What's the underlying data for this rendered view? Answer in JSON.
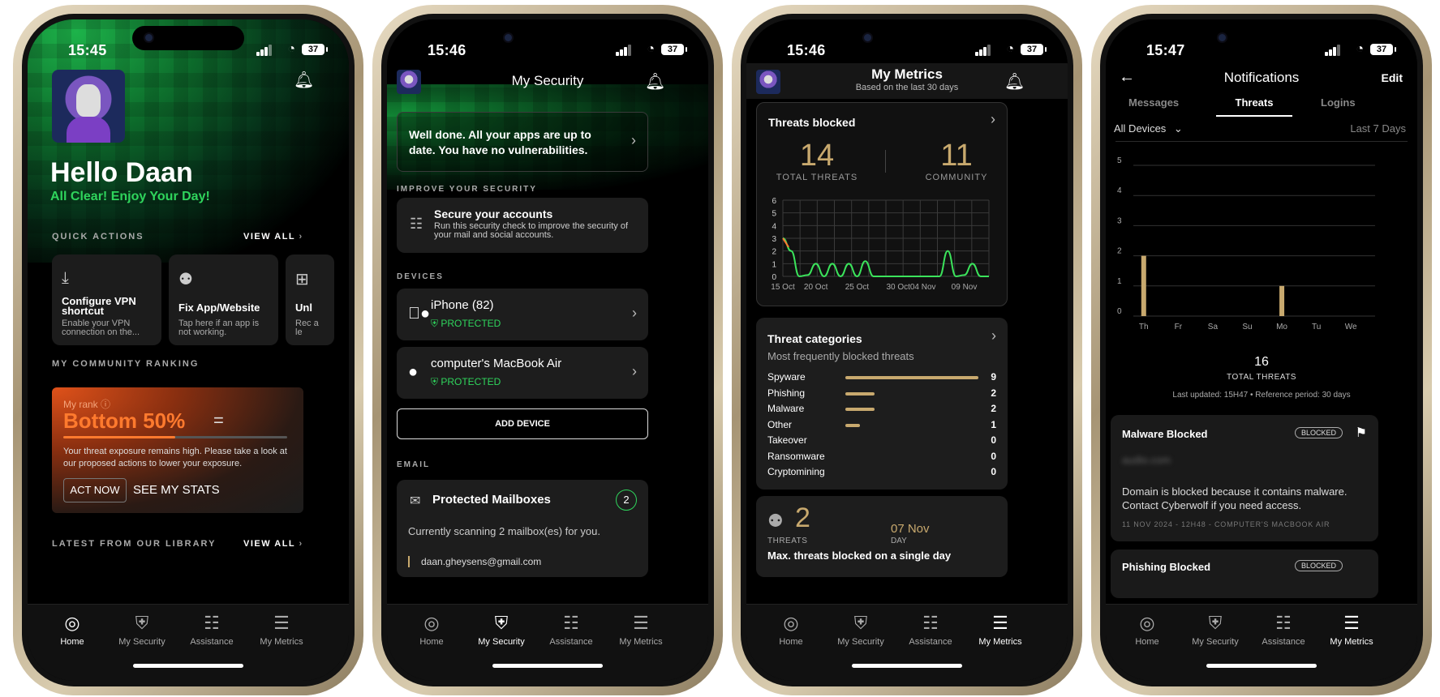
{
  "status": {
    "time1": "15:45",
    "time2": "15:46",
    "time3": "15:46",
    "time4": "15:47",
    "battery": "37"
  },
  "tabs": [
    {
      "label": "Home"
    },
    {
      "label": "My Security"
    },
    {
      "label": "Assistance"
    },
    {
      "label": "My Metrics"
    }
  ],
  "home": {
    "greeting": "Hello Daan",
    "subtitle": "All Clear! Enjoy Your Day!",
    "quick_actions_title": "QUICK ACTIONS",
    "view_all": "VIEW ALL",
    "quick_actions": [
      {
        "title": "Configure VPN shortcut",
        "desc": "Enable your VPN connection on the..."
      },
      {
        "title": "Fix App/Website",
        "desc": "Tap here if an app is not working."
      },
      {
        "title": "Unl",
        "desc": "Rec a le"
      }
    ],
    "ranking_title": "MY COMMUNITY RANKING",
    "rank_label": "My rank",
    "rank_value": "Bottom 50%",
    "rank_desc": "Your threat exposure remains high. Please take a look at our proposed actions to lower your exposure.",
    "act_now": "ACT NOW",
    "see_stats": "SEE MY STATS",
    "library_title": "LATEST FROM OUR LIBRARY"
  },
  "security": {
    "title": "My Security",
    "banner": "Well done. All your apps are up to date. You have no vulnerabilities.",
    "improve_title": "IMPROVE YOUR SECURITY",
    "secure_title": "Secure your accounts",
    "secure_desc": "Run this security check to improve the security of your mail and social accounts.",
    "devices_title": "DEVICES",
    "devices": [
      {
        "name": "iPhone (82)",
        "status": "PROTECTED"
      },
      {
        "name": "computer's MacBook Air",
        "status": "PROTECTED"
      }
    ],
    "add_device": "ADD DEVICE",
    "email_title": "EMAIL",
    "mailboxes_title": "Protected Mailboxes",
    "mailboxes_count": "2",
    "mailboxes_desc": "Currently scanning 2 mailbox(es) for you.",
    "mailbox_email": "daan.gheysens@gmail.com"
  },
  "metrics": {
    "title": "My Metrics",
    "subtitle": "Based on the last 30 days",
    "threats_blocked": "Threats blocked",
    "total_threats": "14",
    "total_label": "TOTAL THREATS",
    "community": "11",
    "community_label": "COMMUNITY",
    "categories_title": "Threat categories",
    "categories_sub": "Most frequently blocked threats",
    "categories": [
      {
        "name": "Spyware",
        "value": 9
      },
      {
        "name": "Phishing",
        "value": 2
      },
      {
        "name": "Malware",
        "value": 2
      },
      {
        "name": "Other",
        "value": 1
      },
      {
        "name": "Takeover",
        "value": 0
      },
      {
        "name": "Ransomware",
        "value": 0
      },
      {
        "name": "Cryptomining",
        "value": 0
      }
    ],
    "max_value": "2",
    "max_label": "THREATS",
    "max_date": "07 Nov",
    "max_date_label": "DAY",
    "max_title": "Max. threats blocked on a single day"
  },
  "notifications": {
    "title": "Notifications",
    "edit": "Edit",
    "tabs": [
      "Messages",
      "Threats",
      "Logins"
    ],
    "filter": "All Devices",
    "period": "Last 7 Days",
    "total": "16",
    "total_label": "TOTAL THREATS",
    "updated": "Last updated: 15H47 • Reference period: 30 days",
    "card1_title": "Malware Blocked",
    "card1_badge": "BLOCKED",
    "card1_domain": "audio.com",
    "card1_desc": "Domain is blocked because it contains malware. Contact Cyberwolf if you need access.",
    "card1_meta": "11 NOV 2024 - 12H48 - COMPUTER'S MACBOOK AIR",
    "card2_title": "Phishing Blocked",
    "card2_badge": "BLOCKED"
  },
  "chart_data": [
    {
      "type": "line",
      "x": [
        "15 Oct",
        "17 Oct",
        "18 Oct",
        "19 Oct",
        "20 Oct",
        "21 Oct",
        "22 Oct",
        "23 Oct",
        "24 Oct",
        "25 Oct",
        "26 Oct",
        "27 Oct",
        "28 Oct",
        "29 Oct",
        "30 Oct",
        "01 Nov",
        "03 Nov",
        "04 Nov",
        "05 Nov",
        "06 Nov",
        "07 Nov",
        "08 Nov",
        "09 Nov",
        "10 Nov",
        "11 Nov",
        "12 Nov"
      ],
      "values": [
        3,
        2,
        0,
        0.1,
        1,
        0,
        1,
        0,
        1,
        0,
        1.2,
        0,
        0,
        0,
        0,
        0,
        0,
        0,
        0,
        0,
        2,
        0,
        0.1,
        1,
        0,
        0
      ],
      "xticks": [
        "15 Oct",
        "20 Oct",
        "25 Oct",
        "30 Oct",
        "04 Nov",
        "09 Nov"
      ],
      "ylim": [
        0,
        6
      ],
      "yticks": [
        0,
        1,
        2,
        3,
        4,
        5,
        6
      ],
      "grid": true
    },
    {
      "type": "bar",
      "categories": [
        "Th",
        "Fr",
        "Sa",
        "Su",
        "Mo",
        "Tu",
        "We"
      ],
      "values": [
        2,
        0,
        0,
        0,
        1,
        0,
        0
      ],
      "ylim": [
        0,
        5
      ],
      "yticks": [
        0,
        1,
        2,
        3,
        4,
        5
      ],
      "grid": true
    }
  ],
  "colors": {
    "accent_gold": "#c8a96e",
    "green": "#2fd45c",
    "line_green": "#3be35b",
    "orange": "#ff7a2e"
  }
}
